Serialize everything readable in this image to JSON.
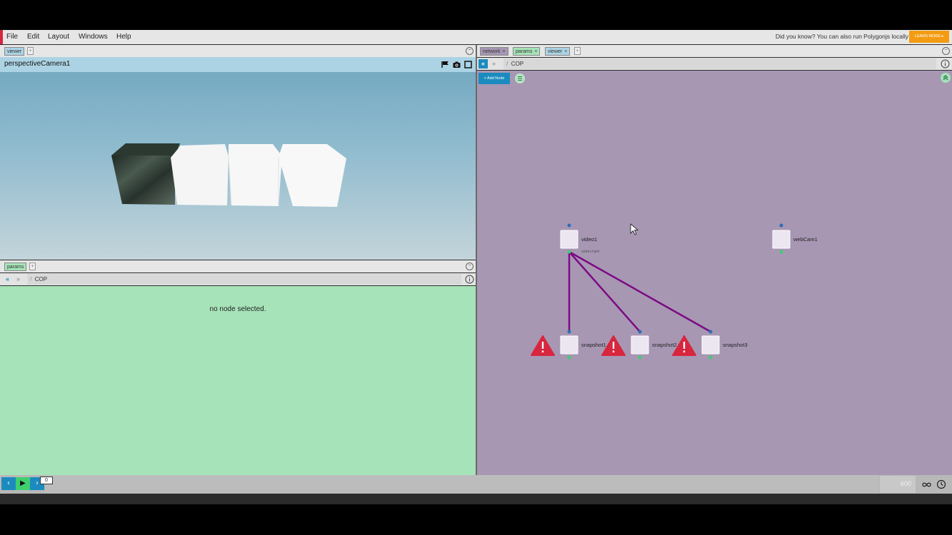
{
  "menu": {
    "items": [
      "File",
      "Edit",
      "Layout",
      "Windows",
      "Help"
    ]
  },
  "banner": {
    "tip": "Did you know? You can also run Polygonjs locally",
    "learn_more": "LEARN MORE ▸"
  },
  "left_top_panel": {
    "tabs": [
      {
        "label": "viewer"
      }
    ],
    "add": "+",
    "camera_name": "perspectiveCamera1"
  },
  "left_bottom_panel": {
    "tabs": [
      {
        "label": "params"
      }
    ],
    "add": "+",
    "path": "COP",
    "path_sep": "/",
    "empty_message": "no node selected."
  },
  "right_panel": {
    "tabs": [
      {
        "label": "network",
        "close": "×"
      },
      {
        "label": "params",
        "close": "×"
      },
      {
        "label": "viewer",
        "close": "×"
      }
    ],
    "add": "+",
    "path": "COP",
    "path_sep": "/",
    "add_node_label": "+ Add Node",
    "nodes": [
      {
        "name": "video1",
        "sublabel": "sintel.mp4"
      },
      {
        "name": "webCam1"
      },
      {
        "name": "snapshot1",
        "error": true
      },
      {
        "name": "snapshot2",
        "error": true
      },
      {
        "name": "snapshot3",
        "error": true
      }
    ]
  },
  "timeline": {
    "current_frame": "0",
    "end_frame": "600"
  },
  "colors": {
    "accent": "#d7263d",
    "viewer_header": "#acd3e4",
    "params_bg": "#a6e3b8",
    "network_bg": "#a797b3",
    "connection": "#7d0a84",
    "error": "#d7263d",
    "primary_button": "#1b8bbf",
    "learn_more": "#f39c12"
  }
}
